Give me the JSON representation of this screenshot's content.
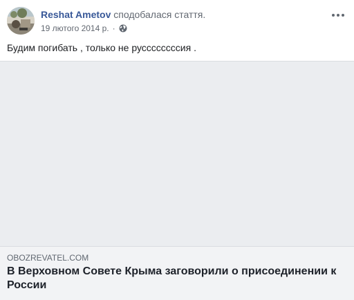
{
  "post": {
    "author": "Reshat Ametov",
    "action": "сподобалася стаття.",
    "date": "19 лютого 2014 р.",
    "separator": "·",
    "privacy_icon": "globe-icon",
    "menu_icon": "more-options-icon",
    "text": "Будим погибать , только не руссссссссия ."
  },
  "link": {
    "domain": "OBOZREVATEL.COM",
    "title": "В Верховном Совете Крыма заговорили о присоединении к России"
  },
  "colors": {
    "author": "#385898",
    "secondary_text": "#616770",
    "media_placeholder": "#ebedf0",
    "link_background": "#f2f3f5"
  }
}
